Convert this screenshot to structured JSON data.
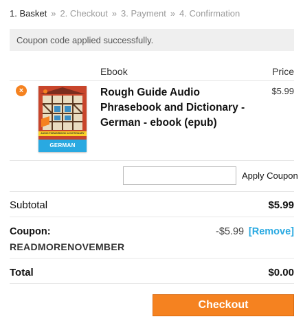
{
  "steps": [
    {
      "label": "1. Basket"
    },
    {
      "label": "2. Checkout"
    },
    {
      "label": "3. Payment"
    },
    {
      "label": "4. Confirmation"
    }
  ],
  "step_separator": "»",
  "notice": "Coupon code applied successfully.",
  "table": {
    "col_product": "Ebook",
    "col_price": "Price"
  },
  "item": {
    "title": "Rough Guide Audio Phrasebook and Dictionary - German - ebook (epub)",
    "price": "$5.99",
    "remove_icon": "×",
    "cover": {
      "band_text": "GERMAN",
      "subband_text": "AUDIO PHRASEBOOK & DICTIONARY",
      "band_color": "#29a9e1",
      "background_color": "#c8452b"
    }
  },
  "coupon": {
    "input_value": "",
    "input_placeholder": "",
    "apply_label": "Apply Coupon"
  },
  "totals": {
    "subtotal_label": "Subtotal",
    "subtotal_value": "$5.99",
    "coupon_label": "Coupon:",
    "coupon_code": "READMORENOVEMBER",
    "coupon_amount": "-$5.99",
    "coupon_remove": "[Remove]",
    "total_label": "Total",
    "total_value": "$0.00"
  },
  "checkout_label": "Checkout",
  "colors": {
    "accent": "#f58220",
    "link": "#29a9e1"
  }
}
